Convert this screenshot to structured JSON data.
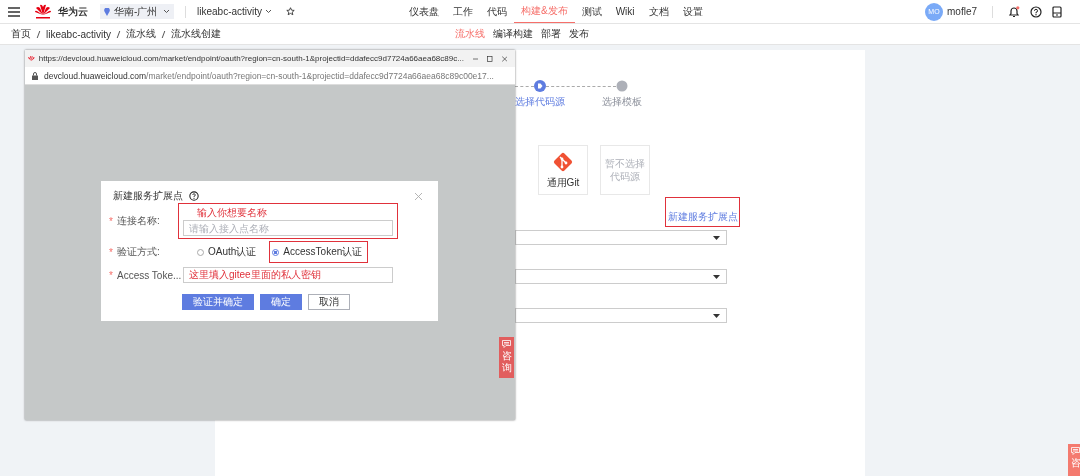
{
  "top_nav": {
    "brand": "华为云",
    "region": "华南-广州",
    "project": "likeabc-activity",
    "menu": [
      {
        "label": "仪表盘",
        "selected": false
      },
      {
        "label": "工作",
        "selected": false
      },
      {
        "label": "代码",
        "selected": false
      },
      {
        "label": "构建&发布",
        "selected": true
      },
      {
        "label": "测试",
        "selected": false
      },
      {
        "label": "Wiki",
        "selected": false
      },
      {
        "label": "文档",
        "selected": false
      },
      {
        "label": "设置",
        "selected": false
      }
    ],
    "user": {
      "initials": "MO",
      "name": "mofle7"
    },
    "unread_notifications": true
  },
  "breadcrumb": [
    "首页",
    "likeabc-activity",
    "流水线",
    "流水线创建"
  ],
  "sub_tabs": [
    {
      "label": "流水线",
      "selected": true
    },
    {
      "label": "编译构建",
      "selected": false
    },
    {
      "label": "部署",
      "selected": false
    },
    {
      "label": "发布",
      "selected": false
    }
  ],
  "steps": [
    {
      "label": "选择代码源",
      "active": true
    },
    {
      "label": "选择模板",
      "active": false
    }
  ],
  "source_cards": [
    {
      "kind": "git",
      "label": "通用Git"
    },
    {
      "kind": "none",
      "label": "暂不选择代码源"
    }
  ],
  "new_endpoint_link": {
    "label": "新建服务扩展点",
    "highlighted": true
  },
  "selects": [
    {
      "open": false
    },
    {
      "open": false
    },
    {
      "open": false
    }
  ],
  "popup": {
    "title": "https://devcloud.huaweicloud.com/market/endpoint/oauth?region=cn-south-1&projectid=ddafecc9d7724a66aea68c89c...",
    "address_domain": "devcloud.huaweicloud.com",
    "address_path": "/market/endpoint/oauth?region=cn-south-1&projectid=ddafecc9d7724a66aea68c89c00e17..."
  },
  "dialog": {
    "title": "新建服务扩展点",
    "fields": [
      {
        "kind": "text",
        "label": "连接名称:",
        "required_mark": "*",
        "placeholder": "请输入接入点名称",
        "highlighted": true,
        "annotation": "输入你想要名称"
      },
      {
        "kind": "radio",
        "label": "验证方式:",
        "required_mark": "*",
        "options": [
          {
            "label": "OAuth认证",
            "selected": false,
            "highlighted": false
          },
          {
            "label": "AccessToken认证",
            "selected": true,
            "highlighted": true
          }
        ]
      },
      {
        "kind": "text",
        "label": "Access Toke...",
        "required_mark": "*",
        "value": "这里填入gitee里面的私人密钥",
        "highlighted": false
      }
    ],
    "buttons": [
      {
        "label": "验证并确定",
        "primary": true
      },
      {
        "label": "确定",
        "primary": true
      },
      {
        "label": "取消",
        "primary": false
      }
    ]
  },
  "consult_tabs": [
    {
      "label": "咨询"
    },
    {
      "label": "咨"
    }
  ]
}
